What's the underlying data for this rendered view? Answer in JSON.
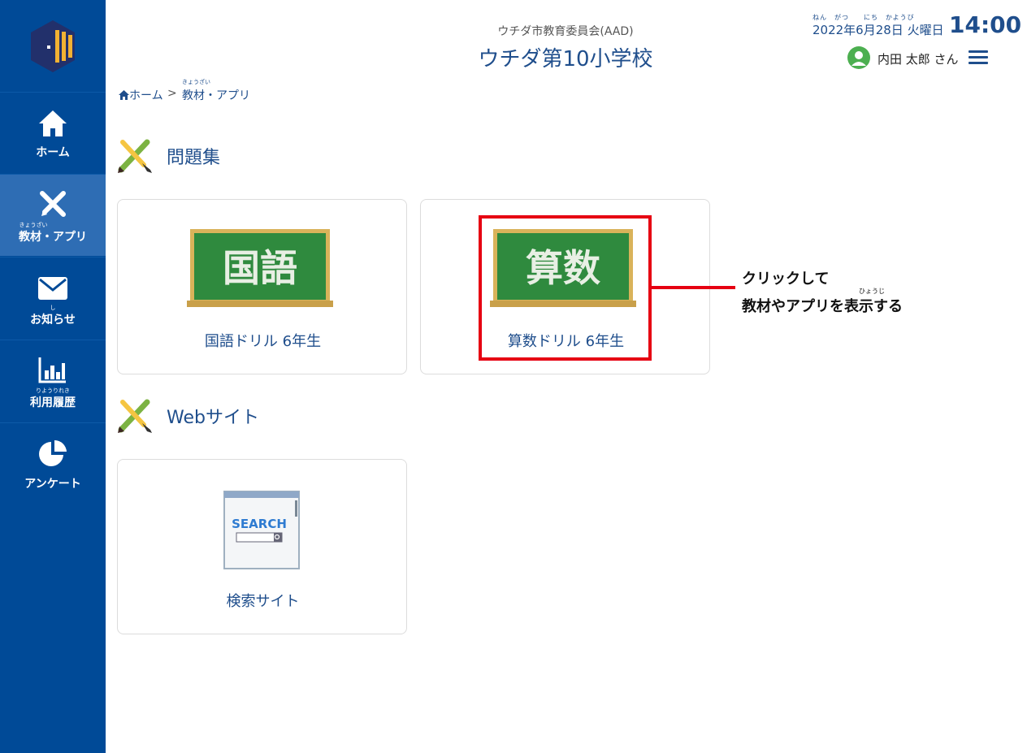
{
  "sidebar": {
    "items": [
      {
        "label": "ホーム",
        "ruby": "",
        "icon": "home-icon"
      },
      {
        "label": "教材・アプリ",
        "ruby": "きょうざい",
        "icon": "pencil-brush-icon",
        "active": true
      },
      {
        "label": "お知らせ",
        "ruby": "し",
        "icon": "mail-icon"
      },
      {
        "label": "利用履歴",
        "ruby": "りようりれき",
        "icon": "bar-chart-icon"
      },
      {
        "label": "アンケート",
        "ruby": "",
        "icon": "pie-chart-icon"
      }
    ]
  },
  "header": {
    "org_name": "ウチダ市教育委員会(AAD)",
    "school_name": "ウチダ第10小学校",
    "date_ruby": "ねん　がつ　　にち　かようび",
    "date": "2022年6月28日 火曜日",
    "time": "14:00",
    "user_name": "内田 太郎 さん"
  },
  "breadcrumb": {
    "home": "ホーム",
    "separator": ">",
    "current_ruby": "きょうざい",
    "current": "教材・アプリ"
  },
  "sections": [
    {
      "title": "問題集",
      "cards": [
        {
          "label": "国語ドリル 6年生",
          "board_text": "国語"
        },
        {
          "label": "算数ドリル 6年生",
          "board_text": "算数"
        }
      ]
    },
    {
      "title": "Webサイト",
      "cards": [
        {
          "label": "検索サイト",
          "image_text": "SEARCH"
        }
      ]
    }
  ],
  "callout": {
    "line1": "クリックして",
    "ruby": "ひょうじ",
    "line2": "教材やアプリを表示する"
  },
  "colors": {
    "sidebar_bg": "#004a97",
    "sidebar_active": "#2e6db4",
    "text_blue": "#1f4e8c",
    "highlight_red": "#e60012",
    "board_green": "#2f8a3e"
  }
}
